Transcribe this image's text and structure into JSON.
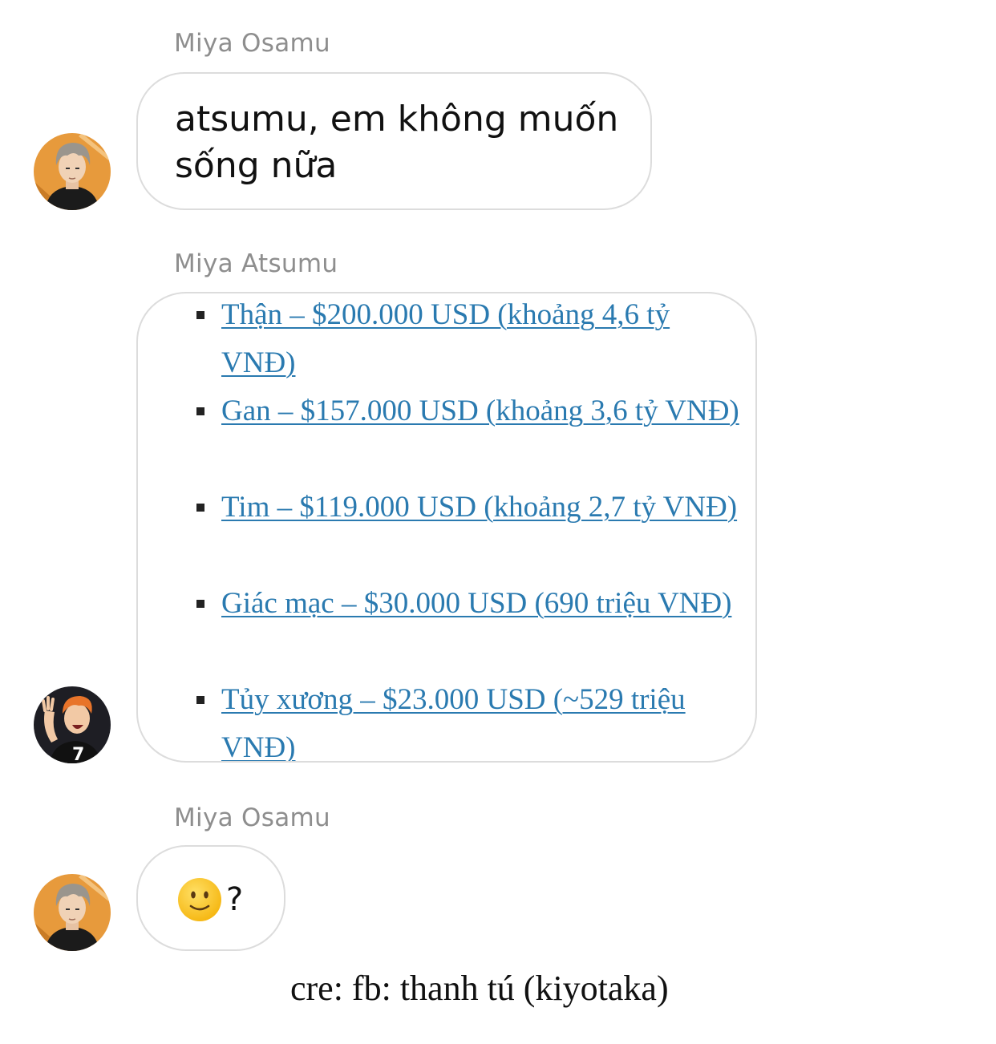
{
  "messages": [
    {
      "sender": "Miya Osamu",
      "text": "atsumu, em không muốn sống nữa"
    },
    {
      "sender": "Miya Atsumu",
      "list_items": [
        "Thận – $200.000 USD (khoảng 4,6 tỷ VNĐ)",
        "Gan – $157.000 USD (khoảng 3,6 tỷ VNĐ)",
        "Tim – $119.000 USD (khoảng 2,7 tỷ VNĐ)",
        "Giác mạc – $30.000 USD (690 triệu VNĐ)",
        "Tủy xương – $23.000 USD (~529 triệu VNĐ)"
      ]
    },
    {
      "sender": "Miya Osamu",
      "emoji": "slightly-smiling-face-icon",
      "text": "?"
    }
  ],
  "credit": "cre: fb: thanh tú (kiyotaka)",
  "colors": {
    "link": "#2a7ab0",
    "sender_name": "#8e8e8e",
    "bubble_border": "#dcdcdc",
    "avatar_osamu_bg": "#e79a3c",
    "avatar_atsumu_bg": "#1e1e24"
  }
}
